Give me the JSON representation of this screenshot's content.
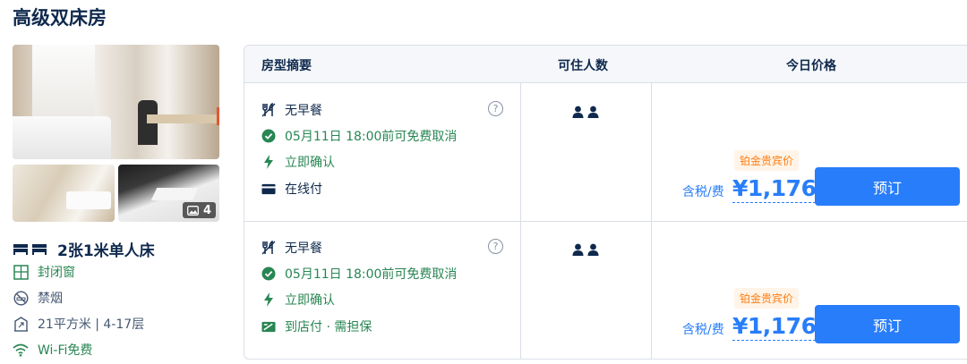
{
  "room": {
    "title": "高级双床房",
    "photo_count": "4",
    "bed": "2张1米单人床",
    "amenities": {
      "window": "封闭窗",
      "smoking": "禁烟",
      "area_floor": "21平方米 | 4-17层",
      "wifi": "Wi-Fi免费"
    }
  },
  "table": {
    "headers": {
      "summary": "房型摘要",
      "occupancy": "可住人数",
      "price": "今日价格"
    },
    "offers": [
      {
        "meal": "无早餐",
        "cancel": "05月11日 18:00前可免费取消",
        "confirm": "立即确认",
        "payment": "在线付",
        "badge": "铂金贵宾价",
        "tax_label": "含税/费",
        "price": "¥1,176",
        "book_label": "预订"
      },
      {
        "meal": "无早餐",
        "cancel": "05月11日 18:00前可免费取消",
        "confirm": "立即确认",
        "payment": "到店付 · 需担保",
        "badge": "铂金贵宾价",
        "tax_label": "含税/费",
        "price": "¥1,176",
        "book_label": "预订"
      }
    ]
  },
  "colors": {
    "primary": "#287dfa",
    "green": "#288653",
    "badge_text": "#ff7d13",
    "badge_bg": "#fff4e7",
    "text": "#0f294d"
  },
  "icons": [
    "utensils-crossed-icon",
    "check-circle-icon",
    "lightning-icon",
    "card-icon",
    "cash-guarantee-icon",
    "help-icon",
    "person-icon",
    "bed-icon",
    "window-icon",
    "no-smoking-icon",
    "area-icon",
    "wifi-icon",
    "image-icon"
  ]
}
